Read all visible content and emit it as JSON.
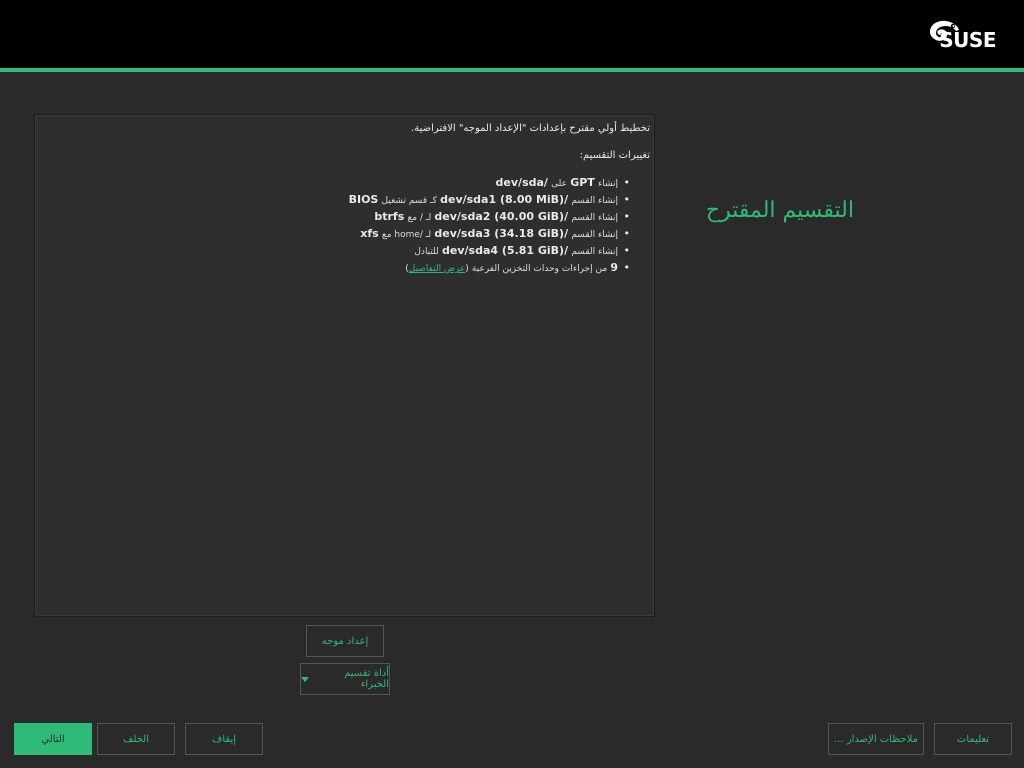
{
  "header": {
    "logo_text": "SUSE",
    "brand_color": "#30ba78"
  },
  "page_title": "التقسيم المقترح",
  "proposal": {
    "intro": "تخطيط أولي مقترح بإعدادات \"الإعداد الموجه\" الافتراضية.",
    "changes_title": "تغييرات التقسيم:",
    "items": [
      {
        "prefix": "إنشاء",
        "main": "GPT",
        "mid": "على",
        "target": "/dev/sda"
      },
      {
        "prefix": "إنشاء القسم",
        "main": "/dev/sda1 (8.00 MiB)",
        "mid": "كـ قسم تشغيل",
        "target": "BIOS"
      },
      {
        "prefix": "إنشاء القسم",
        "main": "/dev/sda2 (40.00 GiB)",
        "mid": "لـ / مع",
        "target": "btrfs"
      },
      {
        "prefix": "إنشاء القسم",
        "main": "/dev/sda3 (34.18 GiB)",
        "mid": "لـ /home مع",
        "target": "xfs"
      },
      {
        "prefix": "إنشاء القسم",
        "main": "/dev/sda4 (5.81 GiB)",
        "mid": "للتبادل",
        "target": ""
      }
    ],
    "subvolumes": {
      "count": "9",
      "text": "من إجراءات وحدات التخزين الفرعية",
      "link": "عرض التفاصيل"
    }
  },
  "buttons": {
    "guided_setup": "إعداد موجه",
    "expert_partitioner": "أداة تقسيم الخبراء",
    "help": "تعليمات",
    "release_notes": "ملاحظات الإصدار ...",
    "abort": "إيقاف",
    "back": "الخلف",
    "next": "التالي"
  }
}
